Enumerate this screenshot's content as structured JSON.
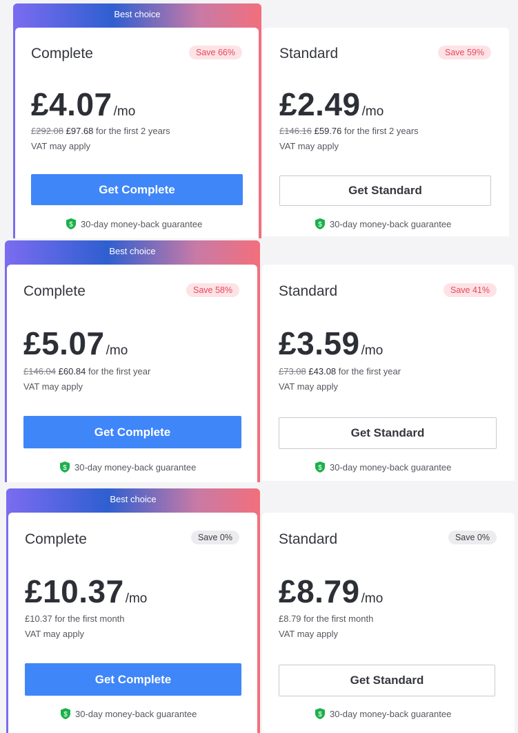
{
  "colors": {
    "primary_button": "#3f86f9",
    "save_pink": "#e8475b",
    "shield_green": "#1ab04a"
  },
  "sections": [
    {
      "best_choice": "Best choice",
      "complete": {
        "name": "Complete",
        "save": "Save 66%",
        "price": "£4.07",
        "per": "/mo",
        "old_price": "£292.08",
        "new_price": "£97.68",
        "term": "for the first 2 years",
        "vat": "VAT may apply",
        "cta": "Get Complete",
        "guarantee": "30-day money-back guarantee"
      },
      "standard": {
        "name": "Standard",
        "save": "Save 59%",
        "price": "£2.49",
        "per": "/mo",
        "old_price": "£146.16",
        "new_price": "£59.76",
        "term": "for the first 2 years",
        "vat": "VAT may apply",
        "cta": "Get Standard",
        "guarantee": "30-day money-back guarantee"
      }
    },
    {
      "best_choice": "Best choice",
      "complete": {
        "name": "Complete",
        "save": "Save 58%",
        "price": "£5.07",
        "per": "/mo",
        "old_price": "£146.04",
        "new_price": "£60.84",
        "term": "for the first year",
        "vat": "VAT may apply",
        "cta": "Get Complete",
        "guarantee": "30-day money-back guarantee"
      },
      "standard": {
        "name": "Standard",
        "save": "Save 41%",
        "price": "£3.59",
        "per": "/mo",
        "old_price": "£73.08",
        "new_price": "£43.08",
        "term": "for the first year",
        "vat": "VAT may apply",
        "cta": "Get Standard",
        "guarantee": "30-day money-back guarantee"
      }
    },
    {
      "best_choice": "Best choice",
      "complete": {
        "name": "Complete",
        "save": "Save 0%",
        "price": "£10.37",
        "per": "/mo",
        "first_month": "£10.37 for the first month",
        "vat": "VAT may apply",
        "cta": "Get Complete",
        "guarantee": "30-day money-back guarantee"
      },
      "standard": {
        "name": "Standard",
        "save": "Save 0%",
        "price": "£8.79",
        "per": "/mo",
        "first_month": "£8.79 for the first month",
        "vat": "VAT may apply",
        "cta": "Get Standard",
        "guarantee": "30-day money-back guarantee"
      }
    }
  ]
}
